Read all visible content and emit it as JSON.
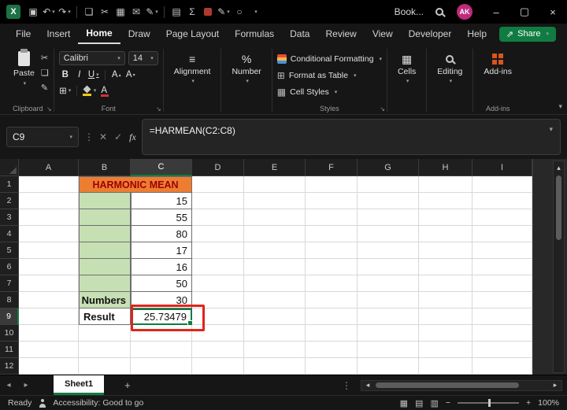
{
  "colors": {
    "accent_green": "#107C41",
    "logo_green": "#1E7145",
    "title_fill": "#ED7D31",
    "title_text": "#9C0006",
    "range_fill": "#C6E0B4",
    "annotation_red": "#E0241B",
    "avatar_pink": "#BF2A7C",
    "addins_orange": "#D9541E"
  },
  "titlebar": {
    "logo_letter": "X",
    "workbook_name": "Book...",
    "avatar_initials": "AK"
  },
  "icons": {
    "save": "▣",
    "undo": "↶",
    "redo": "↷",
    "copy": "❏",
    "cut": "✂",
    "chart": "▦",
    "mail": "✉",
    "draw": "✎",
    "print": "▤",
    "sum": "Σ",
    "ring": "○",
    "minimize": "–",
    "maximize": "▢",
    "close": "×",
    "share_arrow": "⇗",
    "nav_left": "◂",
    "nav_right": "▸",
    "scroll_up": "▴",
    "scroll_down": "▾",
    "dots": "⋮",
    "plus": "+",
    "cancel": "✕",
    "check": "✓",
    "fx": "fx",
    "chevron": "⌄",
    "letter_a": "A",
    "bold": "B",
    "italic": "I",
    "underline": "U",
    "align_lines": "≡",
    "percent": "%",
    "borders_grid": "⊞",
    "table_grid": "⊞",
    "cells_grid": "▦",
    "view_normal": "▦",
    "view_layout": "▤",
    "view_break": "▥",
    "zoom_minus": "−",
    "zoom_plus": "+"
  },
  "menubar": {
    "tabs": [
      "File",
      "Insert",
      "Home",
      "Draw",
      "Page Layout",
      "Formulas",
      "Data",
      "Review",
      "View",
      "Developer",
      "Help"
    ],
    "active_tab": "Home",
    "share_label": "Share"
  },
  "ribbon": {
    "paste_label": "Paste",
    "font_name": "Calibri",
    "font_size": "14",
    "conditional_formatting": "Conditional Formatting",
    "format_as_table": "Format as Table",
    "cell_styles": "Cell Styles",
    "alignment_label": "Alignment",
    "number_label": "Number",
    "cells_label": "Cells",
    "editing_label": "Editing",
    "addins_label": "Add-ins",
    "group_clipboard": "Clipboard",
    "group_font": "Font",
    "group_styles": "Styles",
    "group_addins": "Add-ins"
  },
  "formula_bar": {
    "name_box": "C9",
    "formula": "=HARMEAN(C2:C8)"
  },
  "grid": {
    "selected_cell": "C9",
    "columns": [
      "A",
      "B",
      "C",
      "D",
      "E",
      "F",
      "G",
      "H",
      "I"
    ],
    "rows": [
      "1",
      "2",
      "3",
      "4",
      "5",
      "6",
      "7",
      "8",
      "9",
      "10",
      "11",
      "12"
    ],
    "cells": {
      "B1": "HARMONIC MEAN",
      "C2": "15",
      "C3": "55",
      "C4": "80",
      "C5": "17",
      "C6": "16",
      "C7": "50",
      "C8": "30",
      "B8": "Numbers",
      "B9": "Result",
      "C9": "25.73479"
    }
  },
  "sheetbar": {
    "active_tab": "Sheet1"
  },
  "statusbar": {
    "mode": "Ready",
    "accessibility_text": "Accessibility: Good to go",
    "zoom_level": "100%"
  }
}
